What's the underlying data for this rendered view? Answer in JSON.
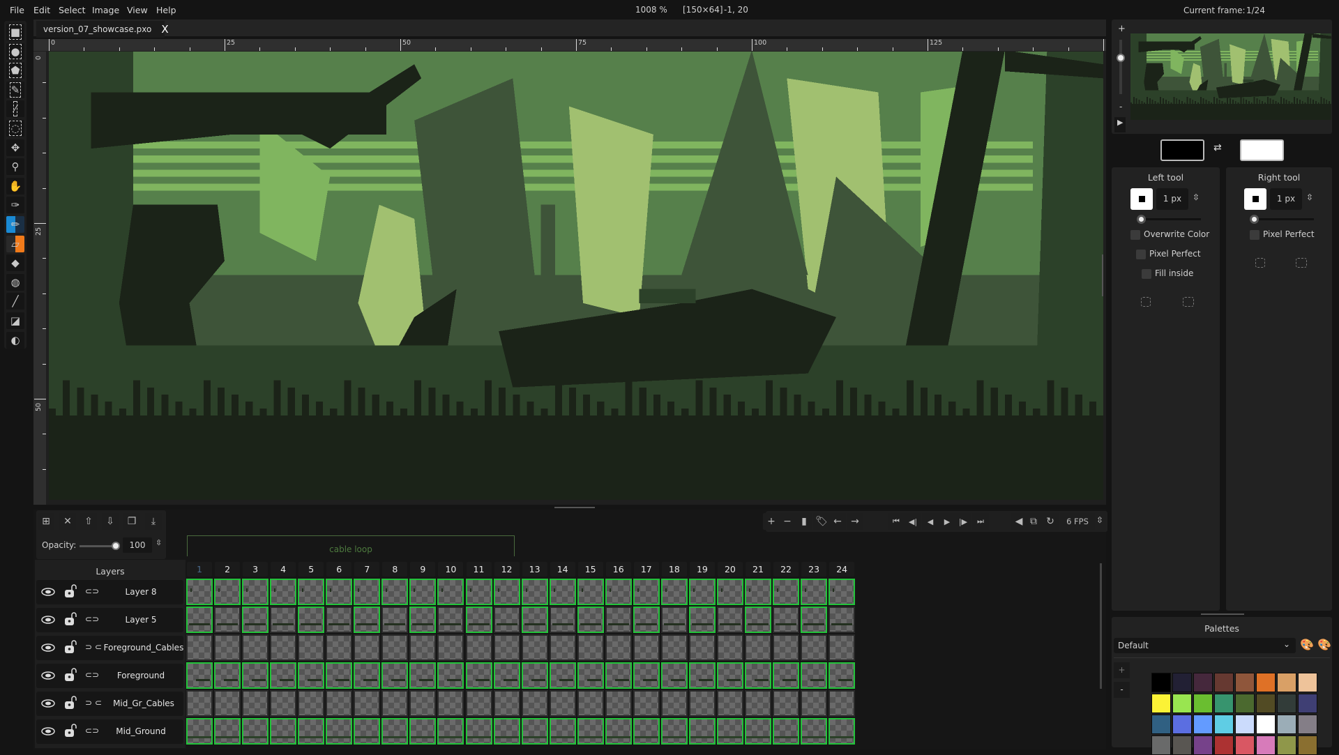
{
  "menu": [
    "File",
    "Edit",
    "Select",
    "Image",
    "View",
    "Help"
  ],
  "status": {
    "zoom": "1008 %",
    "size": "[150×64]",
    "cursor": "-1, 20",
    "current_frame_label": "Current frame:",
    "current_frame": "1/24"
  },
  "tab": {
    "title": "version_07_showcase.pxo",
    "close": "X"
  },
  "ruler": {
    "top": [
      "0",
      "25",
      "50",
      "75",
      "100",
      "125"
    ],
    "left": [
      "0",
      "25",
      "50"
    ]
  },
  "tools": [
    "rectangle-select",
    "ellipse-select",
    "polygon-select",
    "color-select",
    "magic-wand",
    "lasso",
    "move",
    "zoom",
    "pan",
    "color-picker",
    "pencil",
    "eraser",
    "bucket",
    "shading",
    "line-tool",
    "rectangle-tool",
    "ellipse-tool"
  ],
  "active_tools": {
    "left": "pencil",
    "right": "eraser",
    "left_color": "#1a8ad4",
    "right_color": "#f07a1a"
  },
  "art_colors": [
    "#1b2318",
    "#2c4129",
    "#3e5439",
    "#56804b",
    "#80b55f",
    "#a1c070"
  ],
  "timeline": {
    "layer_buttons": [
      "add-layer",
      "remove-layer",
      "move-layer-up",
      "move-layer-down",
      "clone-layer",
      "merge-down"
    ],
    "opacity_label": "Opacity:",
    "opacity": "100",
    "opacity_value": 100,
    "tag": "cable loop",
    "layers_header": "Layers",
    "frame_buttons": [
      "add-frame",
      "remove-frame",
      "clone-frame",
      "frame-tag",
      "move-frame-left",
      "move-frame-right"
    ],
    "playback_buttons": [
      "first-frame",
      "previous-frame",
      "play-backwards",
      "play-forward",
      "next-frame",
      "last-frame"
    ],
    "onion_buttons": [
      "onion-skin-settings",
      "onion-skin-toggle",
      "loop-toggle"
    ],
    "fps": "6 FPS",
    "frames": [
      "1",
      "2",
      "3",
      "4",
      "5",
      "6",
      "7",
      "8",
      "9",
      "10",
      "11",
      "12",
      "13",
      "14",
      "15",
      "16",
      "17",
      "18",
      "19",
      "20",
      "21",
      "22",
      "23",
      "24"
    ],
    "layers": [
      {
        "name": "Layer 8",
        "linked": true,
        "cels": [
          1,
          1,
          1,
          1,
          1,
          1,
          1,
          1,
          1,
          1,
          1,
          1,
          1,
          1,
          1,
          1,
          1,
          1,
          1,
          1,
          1,
          1,
          1,
          1
        ]
      },
      {
        "name": "Layer 5",
        "linked": true,
        "cels": [
          1,
          0,
          1,
          0,
          1,
          0,
          1,
          0,
          1,
          0,
          1,
          0,
          1,
          0,
          1,
          0,
          1,
          0,
          1,
          0,
          1,
          0,
          1,
          0
        ]
      },
      {
        "name": "Foreground_Cables",
        "linked": false,
        "cels": [
          0,
          0,
          0,
          0,
          0,
          0,
          0,
          0,
          0,
          0,
          0,
          0,
          0,
          0,
          0,
          0,
          0,
          0,
          0,
          0,
          0,
          0,
          0,
          0
        ]
      },
      {
        "name": "Foreground",
        "linked": true,
        "cels": [
          1,
          1,
          1,
          1,
          1,
          1,
          1,
          1,
          1,
          1,
          1,
          1,
          1,
          1,
          1,
          1,
          1,
          1,
          1,
          1,
          1,
          1,
          1,
          1
        ]
      },
      {
        "name": "Mid_Gr_Cables",
        "linked": false,
        "cels": [
          0,
          0,
          0,
          0,
          0,
          0,
          0,
          0,
          0,
          0,
          0,
          0,
          0,
          0,
          0,
          0,
          0,
          0,
          0,
          0,
          0,
          0,
          0,
          0
        ]
      },
      {
        "name": "Mid_Ground",
        "linked": true,
        "cels": [
          1,
          1,
          1,
          1,
          1,
          1,
          1,
          1,
          1,
          1,
          1,
          1,
          1,
          1,
          1,
          1,
          1,
          1,
          1,
          1,
          1,
          1,
          1,
          1
        ]
      }
    ]
  },
  "preview": {
    "zoom_in": "+",
    "zoom_out": "-"
  },
  "colors": {
    "left": "#000000",
    "right": "#ffffff"
  },
  "left_tool": {
    "title": "Left tool",
    "size": "1 px",
    "options": [
      "Overwrite Color",
      "Pixel Perfect",
      "Fill inside"
    ]
  },
  "right_tool": {
    "title": "Right tool",
    "size": "1 px",
    "options": [
      "Pixel Perfect"
    ]
  },
  "palettes": {
    "title": "Palettes",
    "selected": "Default",
    "add": "+",
    "remove": "-",
    "colors": [
      "#000000",
      "#222034",
      "#45283c",
      "#663931",
      "#8f563b",
      "#df7126",
      "#d9a066",
      "#eec39a",
      "#fbf236",
      "#99e550",
      "#6abe30",
      "#37946e",
      "#4b692f",
      "#524b24",
      "#323c39",
      "#3f3f74",
      "#306082",
      "#5b6ee1",
      "#639bff",
      "#5fcde4",
      "#cbdbfc",
      "#ffffff",
      "#9badb7",
      "#847e87",
      "#696a6a",
      "#595652",
      "#76428a",
      "#ac3232",
      "#d95763",
      "#d77bba",
      "#8f974a",
      "#8a6f30"
    ]
  }
}
